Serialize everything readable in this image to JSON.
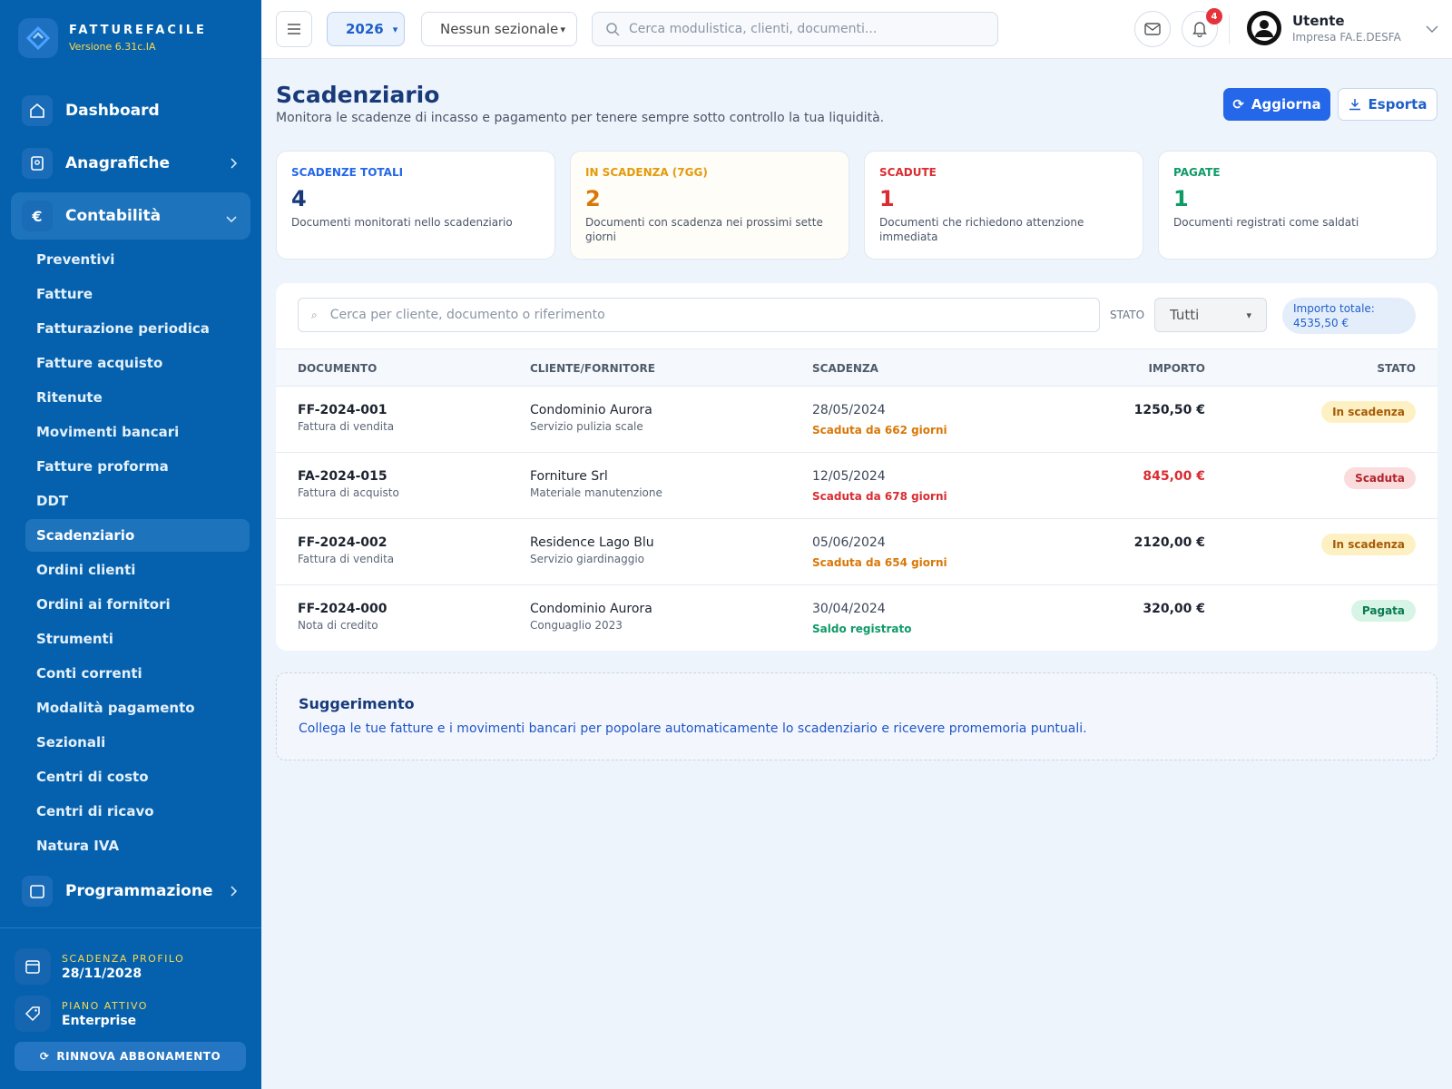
{
  "brand": {
    "name": "FATTUREFACILE",
    "version": "Versione 6.31c.IA"
  },
  "nav": {
    "dashboard": "Dashboard",
    "anagrafiche": "Anagrafiche",
    "contabilita": "Contabilità",
    "programmazione": "Programmazione",
    "sub": [
      "Preventivi",
      "Fatture",
      "Fatturazione periodica",
      "Fatture acquisto",
      "Ritenute",
      "Movimenti bancari",
      "Fatture proforma",
      "DDT",
      "Scadenziario",
      "Ordini clienti",
      "Ordini ai fornitori",
      "Strumenti",
      "Conti correnti",
      "Modalità pagamento",
      "Sezionali",
      "Centri di costo",
      "Centri di ricavo",
      "Natura IVA"
    ],
    "active_sub": "Scadenziario"
  },
  "sidebar_footer": {
    "expiry_label": "SCADENZA PROFILO",
    "expiry_value": "28/11/2028",
    "plan_label": "PIANO ATTIVO",
    "plan_value": "Enterprise",
    "renew": "RINNOVA ABBONAMENTO"
  },
  "topbar": {
    "year": "2026",
    "sezionale": "Nessun sezionale",
    "search_placeholder": "Cerca modulistica, clienti, documenti...",
    "notifications": "4",
    "user_name": "Utente",
    "user_company": "Impresa FA.E.DESFA"
  },
  "page": {
    "title": "Scadenziario",
    "description": "Monitora le scadenze di incasso e pagamento per tenere sempre sotto controllo la tua liquidità.",
    "refresh": "Aggiorna",
    "export": "Esporta"
  },
  "cards": [
    {
      "title": "SCADENZE TOTALI",
      "value": "4",
      "desc": "Documenti monitorati nello scadenziario",
      "color": "#2467e8",
      "value_color": "#183a7a"
    },
    {
      "title": "IN SCADENZA (7GG)",
      "value": "2",
      "desc": "Documenti con scadenza nei prossimi sette giorni",
      "color": "#e39a0c",
      "value_color": "#d97706"
    },
    {
      "title": "SCADUTE",
      "value": "1",
      "desc": "Documenti che richiedono attenzione immediata",
      "color": "#d92d32",
      "value_color": "#d92d32"
    },
    {
      "title": "PAGATE",
      "value": "1",
      "desc": "Documenti registrati come saldati",
      "color": "#0f9a68",
      "value_color": "#0f9a68"
    }
  ],
  "filters": {
    "search_placeholder": "Cerca per cliente, documento o riferimento",
    "stato_label": "STATO",
    "stato_value": "Tutti",
    "total_label": "Importo totale:",
    "total_value": "4535,50 €"
  },
  "table": {
    "headers": [
      "DOCUMENTO",
      "CLIENTE/FORNITORE",
      "SCADENZA",
      "IMPORTO",
      "STATO"
    ],
    "rows": [
      {
        "doc": "FF-2024-001",
        "doc_type": "Fattura di vendita",
        "client": "Condominio Aurora",
        "client_sub": "Servizio pulizia scale",
        "date": "28/05/2024",
        "note": "Scaduta da 662 giorni",
        "amount": "1250,50 €",
        "status": "In scadenza"
      },
      {
        "doc": "FA-2024-015",
        "doc_type": "Fattura di acquisto",
        "client": "Forniture Srl",
        "client_sub": "Materiale manutenzione",
        "date": "12/05/2024",
        "note": "Scaduta da 678 giorni",
        "amount": "845,00 €",
        "status": "Scaduta"
      },
      {
        "doc": "FF-2024-002",
        "doc_type": "Fattura di vendita",
        "client": "Residence Lago Blu",
        "client_sub": "Servizio giardinaggio",
        "date": "05/06/2024",
        "note": "Scaduta da 654 giorni",
        "amount": "2120,00 €",
        "status": "In scadenza"
      },
      {
        "doc": "FF-2024-000",
        "doc_type": "Nota di credito",
        "client": "Condominio Aurora",
        "client_sub": "Conguaglio 2023",
        "date": "30/04/2024",
        "note": "Saldo registrato",
        "amount": "320,00 €",
        "status": "Pagata"
      }
    ]
  },
  "tip": {
    "title": "Suggerimento",
    "text": "Collega le tue fatture e i movimenti bancari per popolare automaticamente lo scadenziario e ricevere promemoria puntuali."
  },
  "colors": {
    "sidebar": "#0561ad",
    "primary": "#2467e8",
    "warning": "#d97706",
    "danger": "#d92d32",
    "success": "#0f9a68"
  }
}
